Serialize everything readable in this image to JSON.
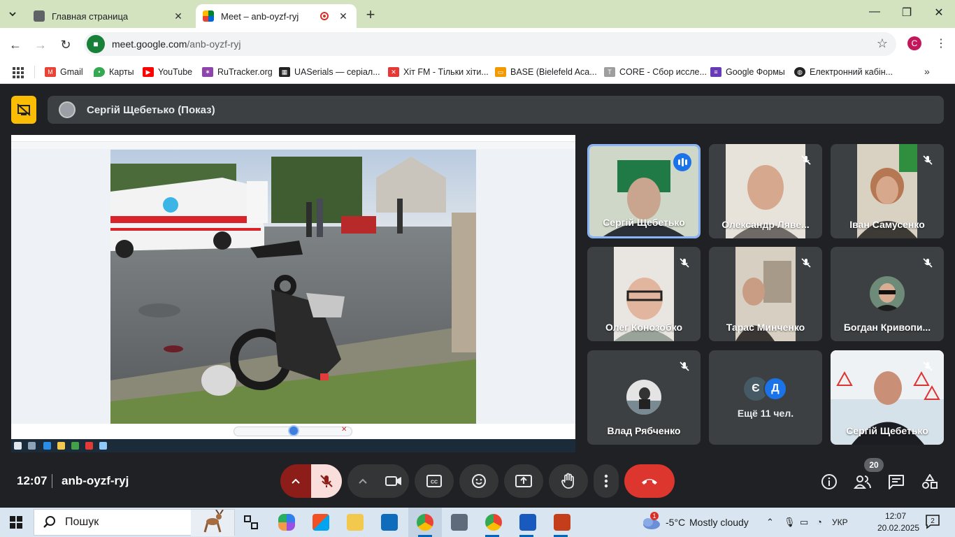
{
  "browser": {
    "tabs": [
      {
        "title": "Главная страница",
        "active": false
      },
      {
        "title": "Meet – anb-oyzf-ryj",
        "active": true
      }
    ],
    "url_host": "meet.google.com",
    "url_path": "/anb-oyzf-ryj",
    "profile_initial": "C",
    "bookmarks": [
      {
        "label": "Gmail",
        "color": "#ea4335"
      },
      {
        "label": "Карты",
        "color": "#34a853"
      },
      {
        "label": "YouTube",
        "color": "#ff0000"
      },
      {
        "label": "RuTracker.org",
        "color": "#8e44ad"
      },
      {
        "label": "UASerials — серіал...",
        "color": "#222222"
      },
      {
        "label": "Хіт FM - Тільки хіти...",
        "color": "#e53935"
      },
      {
        "label": "BASE (Bielefeld Aca...",
        "color": "#f29900"
      },
      {
        "label": "CORE - Сбор иссле...",
        "color": "#9e9e9e"
      },
      {
        "label": "Google Формы",
        "color": "#673ab7"
      },
      {
        "label": "Електронний кабін...",
        "color": "#222222"
      }
    ]
  },
  "meet": {
    "presenter_label": "Сергій Щебетько (Показ)",
    "meeting_time": "12:07",
    "meeting_code": "anb-oyzf-ryj",
    "participants_count": "20",
    "participants": [
      {
        "name": "Сергій Щебетько",
        "muted": false,
        "speaking": true
      },
      {
        "name": "Олександр Ляве...",
        "muted": true
      },
      {
        "name": "Іван Самусенко",
        "muted": true
      },
      {
        "name": "Олег Конозобко",
        "muted": true
      },
      {
        "name": "Тарас Минченко",
        "muted": true
      },
      {
        "name": "Богдан Кривопи...",
        "muted": true
      },
      {
        "name": "Влад Рябченко",
        "muted": true
      },
      {
        "name": "Ещё 11 чел.",
        "avatars": [
          "Є",
          "Д"
        ]
      },
      {
        "name": "Сергій Щебетько",
        "muted": true
      }
    ],
    "colors": {
      "end_call": "#dc362e",
      "speaking_border": "#8ab4f8",
      "present_badge": "#fbbc04"
    }
  },
  "taskbar": {
    "search_label": "Пошук",
    "weather_badge": "1",
    "weather_temp": "-5°C",
    "weather_desc": "Mostly cloudy",
    "language": "УКР",
    "time": "12:07",
    "date": "20.02.2025",
    "notifications": "2"
  }
}
